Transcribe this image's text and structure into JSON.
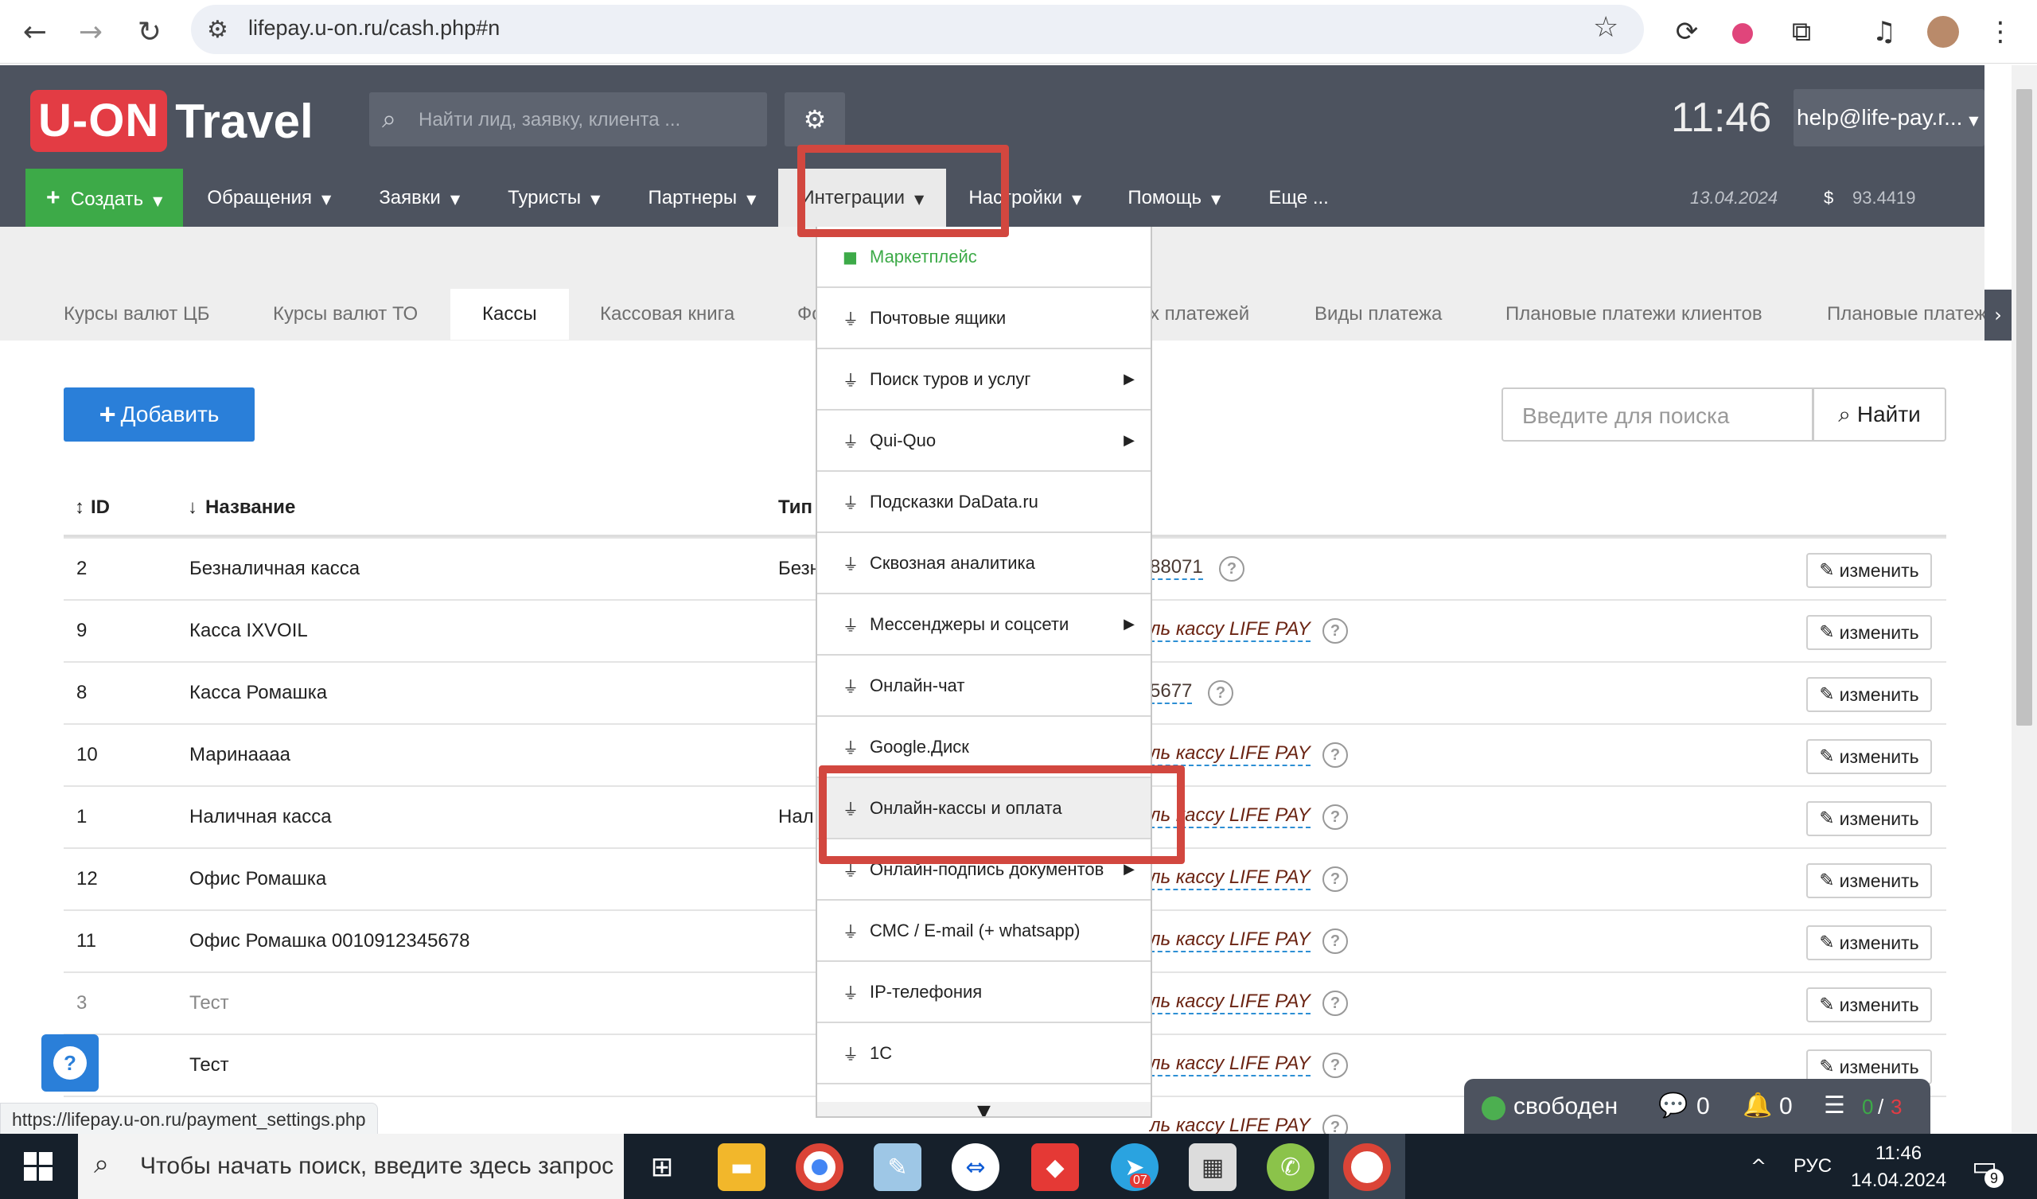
{
  "browser": {
    "url": "lifepay.u-on.ru/cash.php#n",
    "status_url": "https://lifepay.u-on.ru/payment_settings.php"
  },
  "header": {
    "logo_left": "U-ON",
    "logo_right": "Travel",
    "search_placeholder": "Найти лид, заявку, клиента ...",
    "clock": "11:46",
    "user": "help@life-pay.r...",
    "date": "13.04.2024",
    "currency_symbol": "$",
    "rate": "93.4419"
  },
  "nav": {
    "create": "Создать",
    "items": [
      "Обращения",
      "Заявки",
      "Туристы",
      "Партнеры",
      "Интеграции",
      "Настройки",
      "Помощь",
      "Еще ..."
    ]
  },
  "tabs": {
    "items": [
      "Курсы валют ЦБ",
      "Курсы валют ТО",
      "Кассы",
      "Кассовая книга",
      "Фо",
      "х платежей",
      "Виды платежа",
      "Плановые платежи клиентов",
      "Плановые платеж"
    ],
    "active": "Кассы"
  },
  "toolbar": {
    "add_label": "Добавить",
    "search_placeholder": "Введите для поиска",
    "find_label": "Найти"
  },
  "table": {
    "headers": {
      "id": "ID",
      "name": "Название",
      "type": "Тип"
    },
    "edit_label": "изменить",
    "rows": [
      {
        "id": "2",
        "name": "Безналичная касса",
        "type": "Безн",
        "link": "88071"
      },
      {
        "id": "9",
        "name": "Касса IXVOIL",
        "type": "",
        "link": "ль кассу LIFE PAY"
      },
      {
        "id": "8",
        "name": "Касса Ромашка",
        "type": "",
        "link": "5677"
      },
      {
        "id": "10",
        "name": "Маринаааа",
        "type": "",
        "link": "ль кассу LIFE PAY"
      },
      {
        "id": "1",
        "name": "Наличная касса",
        "type": "Нал",
        "link": "ль кассу LIFE PAY"
      },
      {
        "id": "12",
        "name": "Офис Ромашка",
        "type": "",
        "link": "ль кассу LIFE PAY"
      },
      {
        "id": "11",
        "name": "Офис Ромашка 0010912345678",
        "type": "",
        "link": "ль кассу LIFE PAY"
      },
      {
        "id": "3",
        "name": "Тест",
        "type": "",
        "link": "ль кассу LIFE PAY"
      },
      {
        "id": "",
        "name": "Тест",
        "type": "",
        "link": "ль кассу LIFE PAY"
      },
      {
        "id": "",
        "name": "",
        "type": "",
        "link": "ль кассу LIFE PAY"
      }
    ]
  },
  "dropdown": {
    "items": [
      {
        "label": "Маркетплейс",
        "submenu": false
      },
      {
        "label": "Почтовые ящики",
        "submenu": false
      },
      {
        "label": "Поиск туров и услуг",
        "submenu": true
      },
      {
        "label": "Qui-Quo",
        "submenu": true
      },
      {
        "label": "Подсказки DaData.ru",
        "submenu": false
      },
      {
        "label": "Сквозная аналитика",
        "submenu": false
      },
      {
        "label": "Мессенджеры и соцсети",
        "submenu": true
      },
      {
        "label": "Онлайн-чат",
        "submenu": false
      },
      {
        "label": "Google.Диск",
        "submenu": false
      },
      {
        "label": "Онлайн-кассы и оплата",
        "submenu": false
      },
      {
        "label": "Онлайн-подпись документов",
        "submenu": true
      },
      {
        "label": "СМС / E-mail (+ whatsapp)",
        "submenu": false
      },
      {
        "label": "IP-телефония",
        "submenu": false
      },
      {
        "label": "1С",
        "submenu": false
      }
    ]
  },
  "status_widget": {
    "status": "свободен",
    "messages": "0",
    "notifications": "0",
    "tasks_done": "0",
    "tasks_total": "3"
  },
  "taskbar": {
    "search_placeholder": "Чтобы начать поиск, введите здесь запрос",
    "lang": "РУС",
    "time": "11:46",
    "date": "14.04.2024",
    "notif_count": "9",
    "telegram_badge": "07"
  },
  "colors": {
    "header_bg": "#4d535f",
    "create_green": "#3daa48",
    "primary_blue": "#2a7fd9",
    "logo_red": "#e33c44",
    "highlight_red": "#d2473f"
  }
}
